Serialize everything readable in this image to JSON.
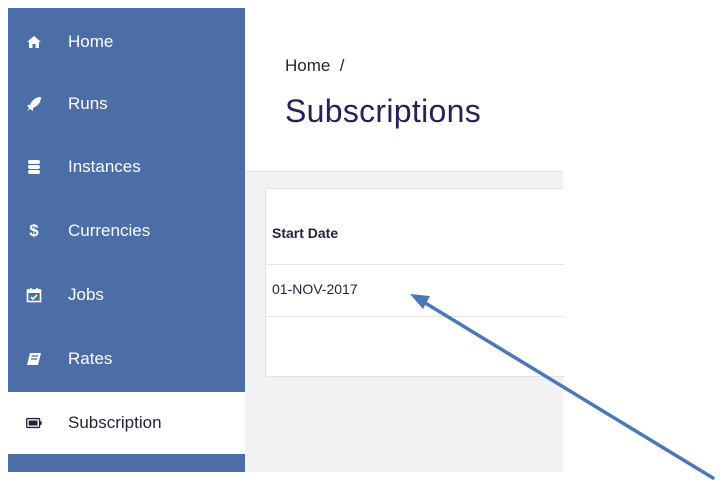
{
  "sidebar": {
    "items": [
      {
        "label": "Home",
        "icon": "home-icon"
      },
      {
        "label": "Runs",
        "icon": "rocket-icon"
      },
      {
        "label": "Instances",
        "icon": "database-icon"
      },
      {
        "label": "Currencies",
        "icon": "dollar-icon"
      },
      {
        "label": "Jobs",
        "icon": "calendar-check-icon"
      },
      {
        "label": "Rates",
        "icon": "book-icon"
      },
      {
        "label": "Subscription",
        "icon": "battery-icon",
        "active": true
      }
    ]
  },
  "header": {
    "breadcrumb": "Home  /",
    "title": "Subscriptions"
  },
  "table": {
    "columns": [
      "Start Date"
    ],
    "rows": [
      [
        "01-NOV-2017"
      ]
    ]
  },
  "colors": {
    "sidebar_bg": "#4a6ea5",
    "title_color": "#23235a",
    "arrow_color": "#4a78b8"
  }
}
